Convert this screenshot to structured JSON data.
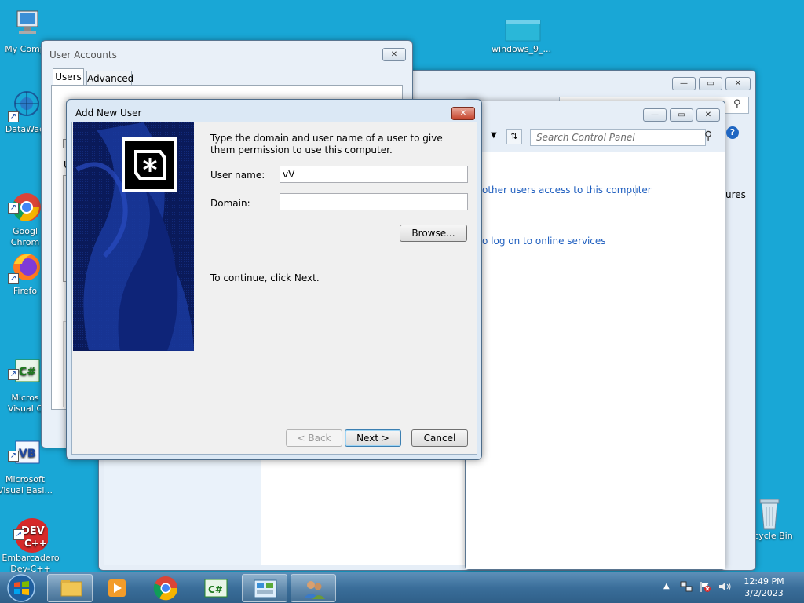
{
  "desktop": {
    "icons_left": [
      {
        "label": "My Comp",
        "icon": "computer-icon"
      },
      {
        "label": "DataWag",
        "icon": "datawag-icon"
      },
      {
        "label": "Googl\nChrom",
        "icon": "chrome-icon"
      },
      {
        "label": "Firefo",
        "icon": "firefox-icon"
      },
      {
        "label": "Micros\nVisual C",
        "icon": "visual-csharp-icon"
      },
      {
        "label": "Microsoft\nVisual Basi...",
        "icon": "visual-basic-icon"
      },
      {
        "label": "Embarcadero\nDev-C++",
        "icon": "devcpp-icon"
      }
    ],
    "folder_label": "windows_9_...",
    "recycle_label": "Recycle Bin"
  },
  "user_accounts_window": {
    "title": "User Accounts",
    "tabs": [
      "Users",
      "Advanced"
    ],
    "fragment_u": "U"
  },
  "control_panel_window": {
    "search_placeholder": "Search Control Panel",
    "link_1": "other users access to this computer",
    "link_2": "o log on to online services",
    "fragment_ures": "ures"
  },
  "dialog": {
    "title": "Add New User",
    "instruction": "Type the domain and user name of a user to give them permission to use this computer.",
    "username_label": "User name:",
    "username_value": "vV",
    "domain_label": "Domain:",
    "domain_value": "",
    "browse_label": "Browse...",
    "continue_text": "To continue, click Next.",
    "back_label": "< Back",
    "next_label": "Next >",
    "cancel_label": "Cancel"
  },
  "taskbar": {
    "time": "12:49 PM",
    "date": "3/2/2023"
  },
  "colors": {
    "desktop": "#19a7d6",
    "link": "#1e5ebf",
    "taskbar": "#3a6e9a"
  }
}
